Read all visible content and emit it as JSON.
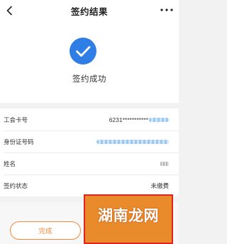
{
  "header": {
    "title": "签约结果"
  },
  "result": {
    "status_text": "签约成功",
    "accent_color": "#2f7ee6"
  },
  "info_rows": [
    {
      "label": "工会卡号",
      "value": "6231***********"
    },
    {
      "label": "身份证号码",
      "value": ""
    },
    {
      "label": "姓名",
      "value": ""
    },
    {
      "label": "签约状态",
      "value": "未缴费"
    }
  ],
  "buttons": {
    "done_label": "完成"
  },
  "watermark": {
    "text": "湖南龙网"
  },
  "icons": {
    "back": "chevron-left-icon",
    "more": "more-dots-icon",
    "success": "check-circle-icon"
  }
}
